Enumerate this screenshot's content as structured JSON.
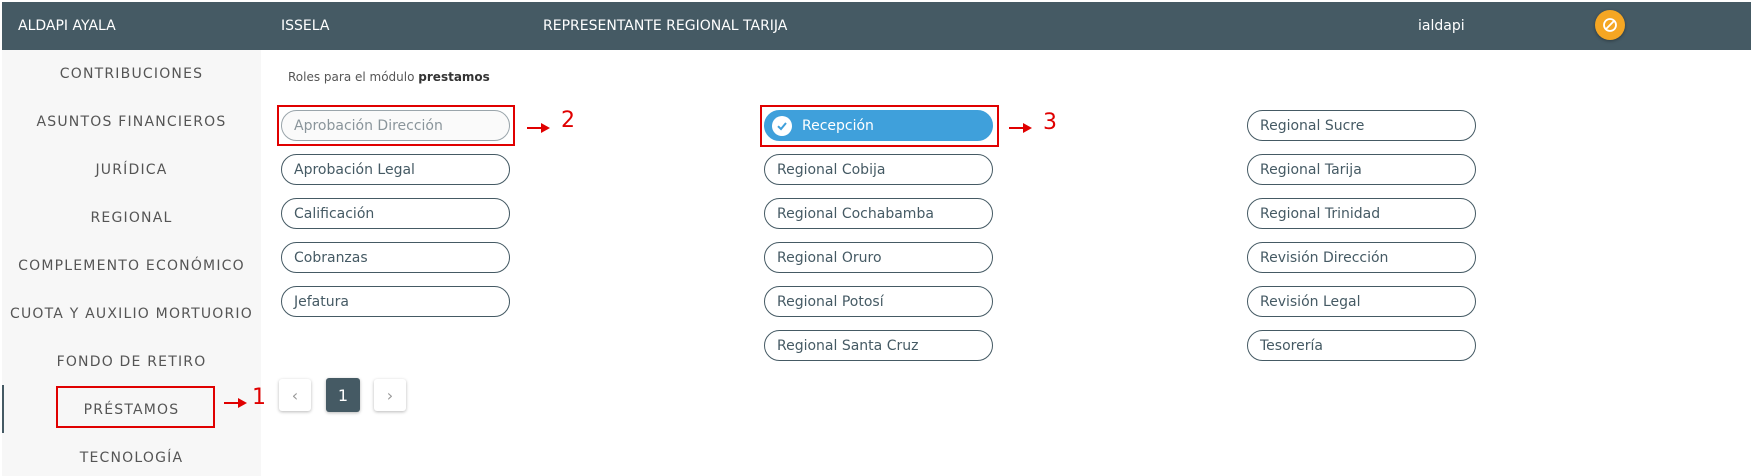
{
  "header": {
    "name": "ALDAPI AYALA",
    "city": "ISSELA",
    "role": "REPRESENTANTE REGIONAL TARIJA",
    "username": "ialdapi",
    "logout_icon": "block-icon",
    "color": "#455a64",
    "accent": "#f5a623"
  },
  "sidebar": {
    "items": [
      {
        "label": "CONTRIBUCIONES"
      },
      {
        "label": "ASUNTOS FINANCIEROS"
      },
      {
        "label": "JURÍDICA"
      },
      {
        "label": "REGIONAL"
      },
      {
        "label": "COMPLEMENTO ECONÓMICO"
      },
      {
        "label": "CUOTA Y AUXILIO MORTUORIO"
      },
      {
        "label": "FONDO DE RETIRO"
      },
      {
        "label": "PRÉSTAMOS"
      },
      {
        "label": "TECNOLOGÍA"
      }
    ],
    "active": "PRÉSTAMOS"
  },
  "main": {
    "heading_prefix": "Roles para el módulo",
    "module": "prestamos",
    "roles": [
      {
        "label": "Aprobación Dirección",
        "state": "disabled"
      },
      {
        "label": "Aprobación Legal",
        "state": "normal"
      },
      {
        "label": "Calificación",
        "state": "normal"
      },
      {
        "label": "Cobranzas",
        "state": "normal"
      },
      {
        "label": "Jefatura",
        "state": "normal"
      },
      {
        "label": "Recepción",
        "state": "selected"
      },
      {
        "label": "Regional Cobija",
        "state": "normal"
      },
      {
        "label": "Regional Cochabamba",
        "state": "normal"
      },
      {
        "label": "Regional Oruro",
        "state": "normal"
      },
      {
        "label": "Regional Potosí",
        "state": "normal"
      },
      {
        "label": "Regional Santa Cruz",
        "state": "normal"
      },
      {
        "label": "Regional Sucre",
        "state": "normal"
      },
      {
        "label": "Regional Tarija",
        "state": "normal"
      },
      {
        "label": "Regional Trinidad",
        "state": "normal"
      },
      {
        "label": "Revisión Dirección",
        "state": "normal"
      },
      {
        "label": "Revisión Legal",
        "state": "normal"
      },
      {
        "label": "Tesorería",
        "state": "normal"
      }
    ],
    "selected_color": "#3fa0db"
  },
  "pagination": {
    "current": "1"
  },
  "annotations": {
    "one": "1",
    "two": "2",
    "three": "3",
    "color": "#e00000"
  }
}
